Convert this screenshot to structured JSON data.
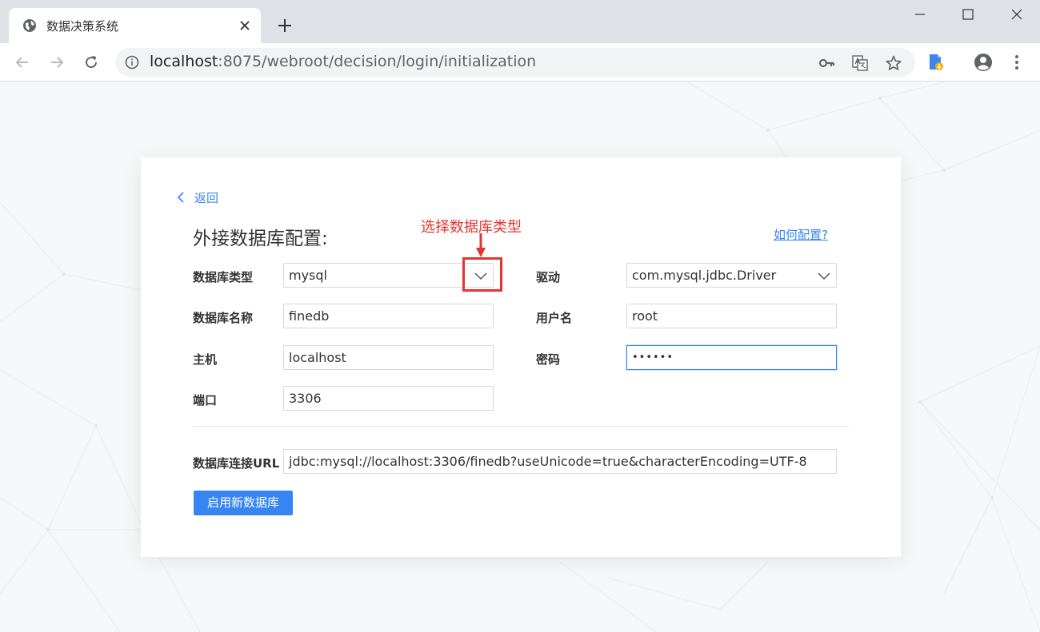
{
  "browser": {
    "tab_title": "数据决策系统",
    "url_host": "localhost",
    "url_path": ":8075/webroot/decision/login/initialization"
  },
  "card": {
    "back_label": "返回",
    "title": "外接数据库配置:",
    "help_link": "如何配置?",
    "annotation": "选择数据库类型",
    "fields": {
      "db_type": {
        "label": "数据库类型",
        "value": "mysql"
      },
      "driver": {
        "label": "驱动",
        "value": "com.mysql.jdbc.Driver"
      },
      "db_name": {
        "label": "数据库名称",
        "value": "finedb"
      },
      "username": {
        "label": "用户名",
        "value": "root"
      },
      "host": {
        "label": "主机",
        "value": "localhost"
      },
      "password": {
        "label": "密码",
        "value": "••••••"
      },
      "port": {
        "label": "端口",
        "value": "3306"
      },
      "url": {
        "label": "数据库连接URL",
        "value": "jdbc:mysql://localhost:3306/finedb?useUnicode=true&characterEncoding=UTF-8"
      }
    },
    "submit_label": "启用新数据库"
  },
  "colors": {
    "accent": "#3685f2",
    "annotation": "#e8332c",
    "tabbar": "#dee1e6"
  },
  "icons": [
    "globe-icon",
    "close-icon",
    "plus-icon",
    "minimize-icon",
    "maximize-icon",
    "window-close-icon",
    "back-arrow-icon",
    "forward-arrow-icon",
    "reload-icon",
    "info-icon",
    "key-icon",
    "translate-icon",
    "star-icon",
    "extension-icon",
    "account-icon",
    "menu-icon",
    "chevron-left-icon",
    "chevron-down-icon",
    "arrow-down-icon"
  ]
}
